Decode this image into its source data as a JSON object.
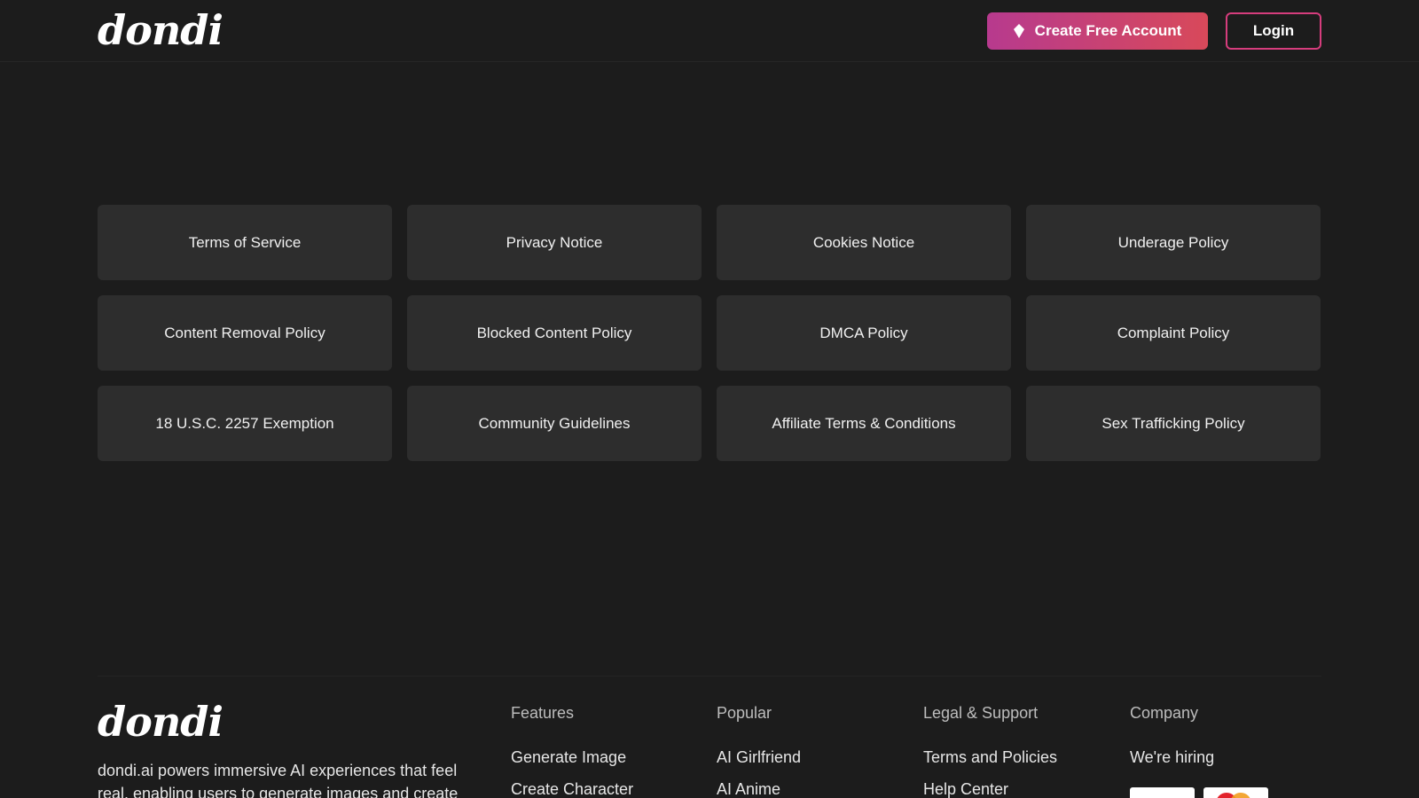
{
  "header": {
    "logo": "dondi",
    "create_account_label": "Create Free Account",
    "login_label": "Login",
    "accent_gradient": [
      "#b73a8e",
      "#d8495a"
    ],
    "login_border": "#d63d7d"
  },
  "policies": [
    "Terms of Service",
    "Privacy Notice",
    "Cookies Notice",
    "Underage Policy",
    "Content Removal Policy",
    "Blocked Content Policy",
    "DMCA Policy",
    "Complaint Policy",
    "18 U.S.C. 2257 Exemption",
    "Community Guidelines",
    "Affiliate Terms & Conditions",
    "Sex Trafficking Policy"
  ],
  "footer": {
    "logo": "dondi",
    "description": "dondi.ai powers immersive AI experiences that feel real, enabling users to generate images and create",
    "columns": [
      {
        "title": "Features",
        "links": [
          "Generate Image",
          "Create Character"
        ]
      },
      {
        "title": "Popular",
        "links": [
          "AI Girlfriend",
          "AI Anime"
        ]
      },
      {
        "title": "Legal & Support",
        "links": [
          "Terms and Policies",
          "Help Center"
        ]
      },
      {
        "title": "Company",
        "links": [
          "We're hiring"
        ]
      }
    ],
    "payment_icons": [
      "visa-card-icon",
      "mastercard-icon"
    ]
  }
}
